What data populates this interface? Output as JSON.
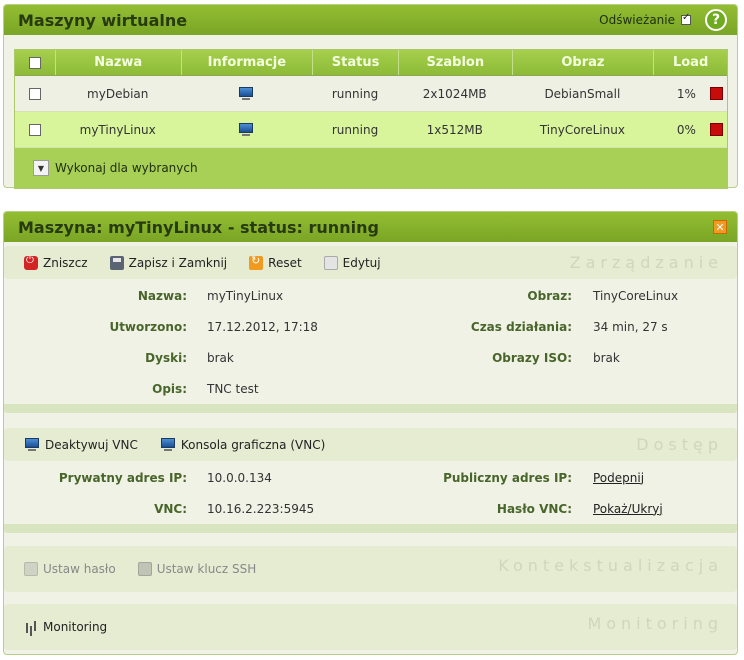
{
  "vm_panel": {
    "title": "Maszyny wirtualne",
    "refresh_label": "Odświeżanie",
    "refresh_checked": true,
    "help_icon": "help-icon",
    "columns": [
      "Nazwa",
      "Informacje",
      "Status",
      "Szablon",
      "Obraz",
      "Load"
    ],
    "rows": [
      {
        "name": "myDebian",
        "status": "running",
        "template": "2x1024MB",
        "image": "DebianSmall",
        "load": "1%"
      },
      {
        "name": "myTinyLinux",
        "status": "running",
        "template": "1x512MB",
        "image": "TinyCoreLinux",
        "load": "0%"
      }
    ],
    "bulk_action_label": "Wykonaj dla wybranych"
  },
  "machine_panel": {
    "title": "Maszyna: myTinyLinux - status: running",
    "management": {
      "section_title": "Zarządzanie",
      "destroy_label": "Zniszcz",
      "save_close_label": "Zapisz i Zamknij",
      "reset_label": "Reset",
      "edit_label": "Edytuj",
      "fields": {
        "name_label": "Nazwa:",
        "name_value": "myTinyLinux",
        "image_label": "Obraz:",
        "image_value": "TinyCoreLinux",
        "created_label": "Utworzono:",
        "created_value": "17.12.2012, 17:18",
        "uptime_label": "Czas działania:",
        "uptime_value": "34 min, 27 s",
        "disks_label": "Dyski:",
        "disks_value": "brak",
        "iso_label": "Obrazy ISO:",
        "iso_value": "brak",
        "desc_label": "Opis:",
        "desc_value": "TNC test"
      }
    },
    "access": {
      "section_title": "Dostęp",
      "deactivate_vnc_label": "Deaktywuj VNC",
      "vnc_console_label": "Konsola graficzna (VNC)",
      "private_ip_label": "Prywatny adres IP:",
      "private_ip_value": "10.0.0.134",
      "public_ip_label": "Publiczny adres IP:",
      "public_ip_value": "Podepnij",
      "vnc_label": "VNC:",
      "vnc_value": "10.16.2.223:5945",
      "vnc_password_label": "Hasło VNC:",
      "vnc_password_value": "Pokaż/Ukryj"
    },
    "contextualization": {
      "section_title": "Kontekstualizacja",
      "set_password_label": "Ustaw hasło",
      "set_ssh_label": "Ustaw klucz SSH"
    },
    "monitoring": {
      "section_title": "Monitoring",
      "monitoring_label": "Monitoring"
    }
  },
  "colors": {
    "accent": "#7aa526",
    "highlight_row": "#d8f59c",
    "load_alert": "#c80b0b"
  }
}
